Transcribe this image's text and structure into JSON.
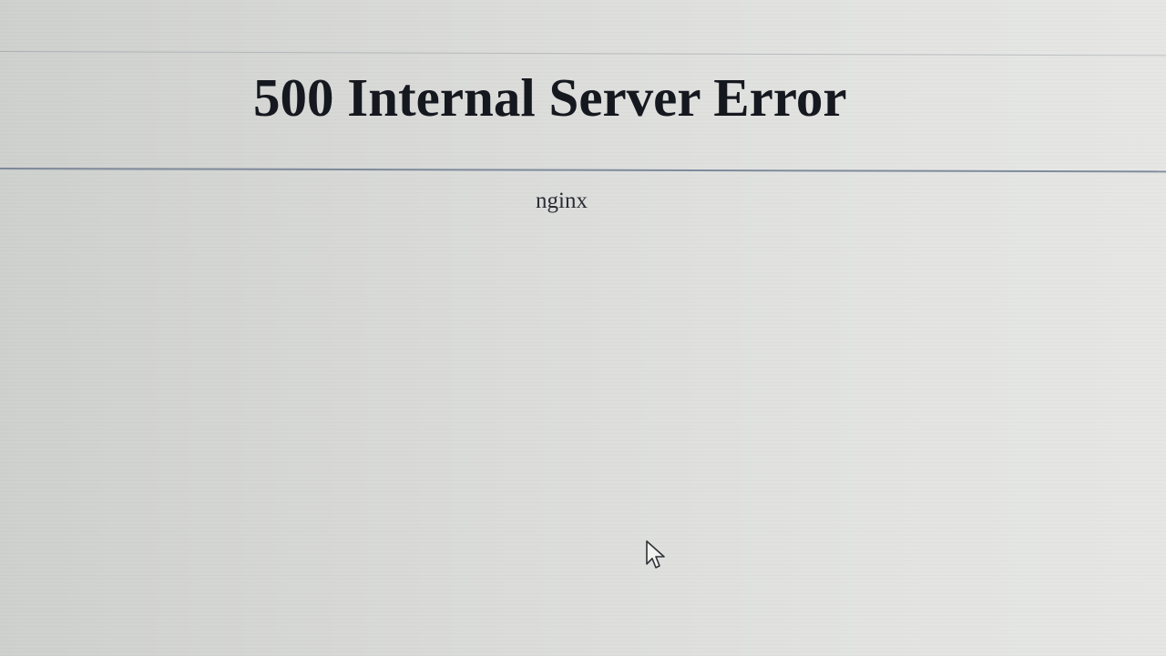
{
  "page": {
    "heading": "500 Internal Server Error",
    "server_signature": "nginx"
  },
  "colors": {
    "background": "#dcdddb",
    "text": "#1b1d22",
    "divider": "#5f6f86"
  },
  "cursor": {
    "icon": "arrow-cursor-icon"
  }
}
